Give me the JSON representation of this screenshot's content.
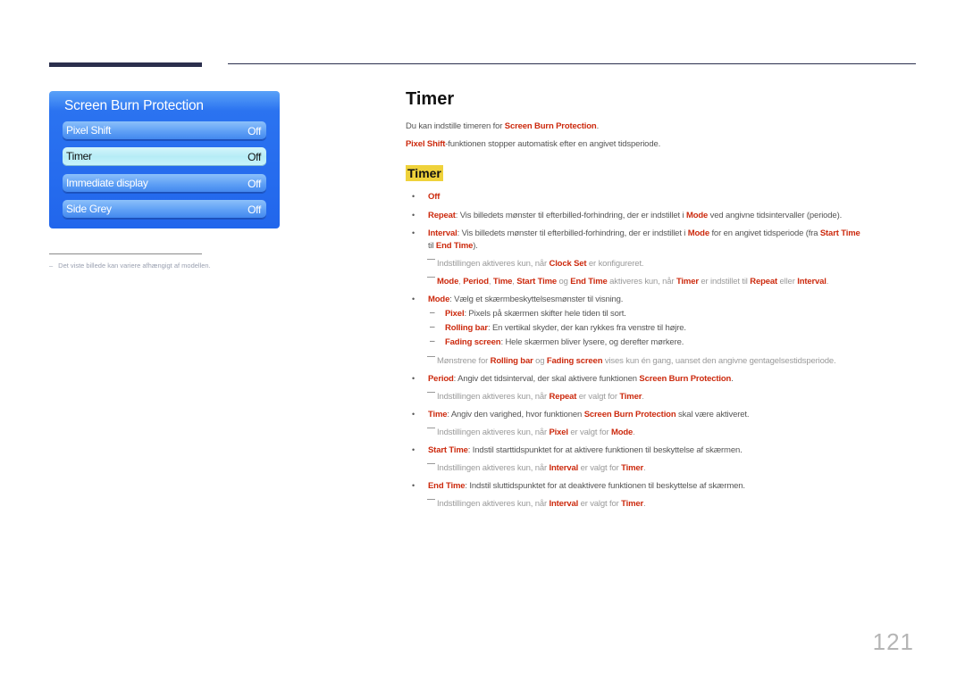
{
  "header": {
    "decor": "header-rule"
  },
  "menu": {
    "title": "Screen Burn Protection",
    "items": [
      {
        "label": "Pixel Shift",
        "value": "Off",
        "selected": false
      },
      {
        "label": "Timer",
        "value": "Off",
        "selected": true
      },
      {
        "label": "Immediate display",
        "value": "Off",
        "selected": false
      },
      {
        "label": "Side Grey",
        "value": "Off",
        "selected": false
      }
    ]
  },
  "footnote": {
    "dash": "–",
    "text": "Det viste billede kan variere afhængigt af modellen."
  },
  "section": {
    "title": "Timer",
    "intro1": {
      "pre": "Du kan indstille timeren for ",
      "hl": "Screen Burn Protection",
      "post": "."
    },
    "intro2": {
      "hl": "Pixel Shift",
      "post": "-funktionen stopper automatisk efter en angivet tidsperiode."
    },
    "subtitle": "Timer"
  },
  "bullets": {
    "off": {
      "hl": "Off"
    },
    "repeat": {
      "hl": "Repeat",
      "t1": ": Vis billedets mønster til efterbilled-forhindring, der er indstillet i ",
      "hl2": "Mode",
      "t2": " ved angivne tidsintervaller (periode)."
    },
    "interval": {
      "hl": "Interval",
      "t1": ": Vis billedets mønster til efterbilled-forhindring, der er indstillet i ",
      "hl2": "Mode",
      "t2": " for en angivet tidsperiode (fra ",
      "hl3": "Start Time",
      "t3": "til ",
      "hl4": "End Time",
      "t4": ")."
    },
    "note_clock": {
      "t1": "Indstillingen aktiveres kun, når ",
      "hl": "Clock Set",
      "t2": " er konfigureret."
    },
    "note_modes": {
      "hl1": "Mode",
      "s1": ", ",
      "hl2": "Period",
      "s2": ", ",
      "hl3": "Time",
      "s3": ", ",
      "hl4": "Start Time",
      "s4": " og ",
      "hl5": "End Time",
      "s5": " aktiveres kun, når ",
      "hl6": "Timer",
      "s6": " er indstillet til ",
      "hl7": "Repeat",
      "s7": " eller ",
      "hl8": "Interval",
      "s8": "."
    },
    "mode": {
      "hl": "Mode",
      "t1": ": Vælg et skærmbeskyttelsesmønster til visning."
    },
    "mode_pixel": {
      "hl": "Pixel",
      "t1": ": Pixels på skærmen skifter hele tiden til sort."
    },
    "mode_rolling": {
      "hl": "Rolling bar",
      "t1": ": En vertikal skyder, der kan rykkes fra venstre til højre."
    },
    "mode_fading": {
      "hl": "Fading screen",
      "t1": ": Hele skærmen bliver lysere, og derefter mørkere."
    },
    "note_patterns": {
      "t1": "Mønstrene for ",
      "hl1": "Rolling bar",
      "t2": " og ",
      "hl2": "Fading screen",
      "t3": " vises kun én gang, uanset den angivne gentagelsestidsperiode."
    },
    "period": {
      "hl": "Period",
      "t1": ": Angiv det tidsinterval, der skal aktivere funktionen ",
      "hl2": "Screen Burn Protection",
      "t2": "."
    },
    "note_period": {
      "t1": "Indstillingen aktiveres kun, når ",
      "hl1": "Repeat",
      "t2": " er valgt for ",
      "hl2": "Timer",
      "t3": "."
    },
    "time": {
      "hl": "Time",
      "t1": ": Angiv den varighed, hvor funktionen ",
      "hl2": "Screen Burn Protection",
      "t2": " skal være aktiveret."
    },
    "note_time": {
      "t1": "Indstillingen aktiveres kun, når ",
      "hl1": "Pixel",
      "t2": " er valgt for ",
      "hl2": "Mode",
      "t3": "."
    },
    "start": {
      "hl": "Start Time",
      "t1": ": Indstil starttidspunktet for at aktivere funktionen til beskyttelse af skærmen."
    },
    "note_start": {
      "t1": "Indstillingen aktiveres kun, når ",
      "hl1": "Interval",
      "t2": " er valgt for ",
      "hl2": "Timer",
      "t3": "."
    },
    "end": {
      "hl": "End Time",
      "t1": ": Indstil sluttidspunktet for at deaktivere funktionen til beskyttelse af skærmen."
    },
    "note_end": {
      "t1": "Indstillingen aktiveres kun, når ",
      "hl1": "Interval",
      "t2": " er valgt for ",
      "hl2": "Timer",
      "t3": "."
    }
  },
  "symbols": {
    "bullet": "•",
    "dash": "–"
  },
  "page_number": "121"
}
